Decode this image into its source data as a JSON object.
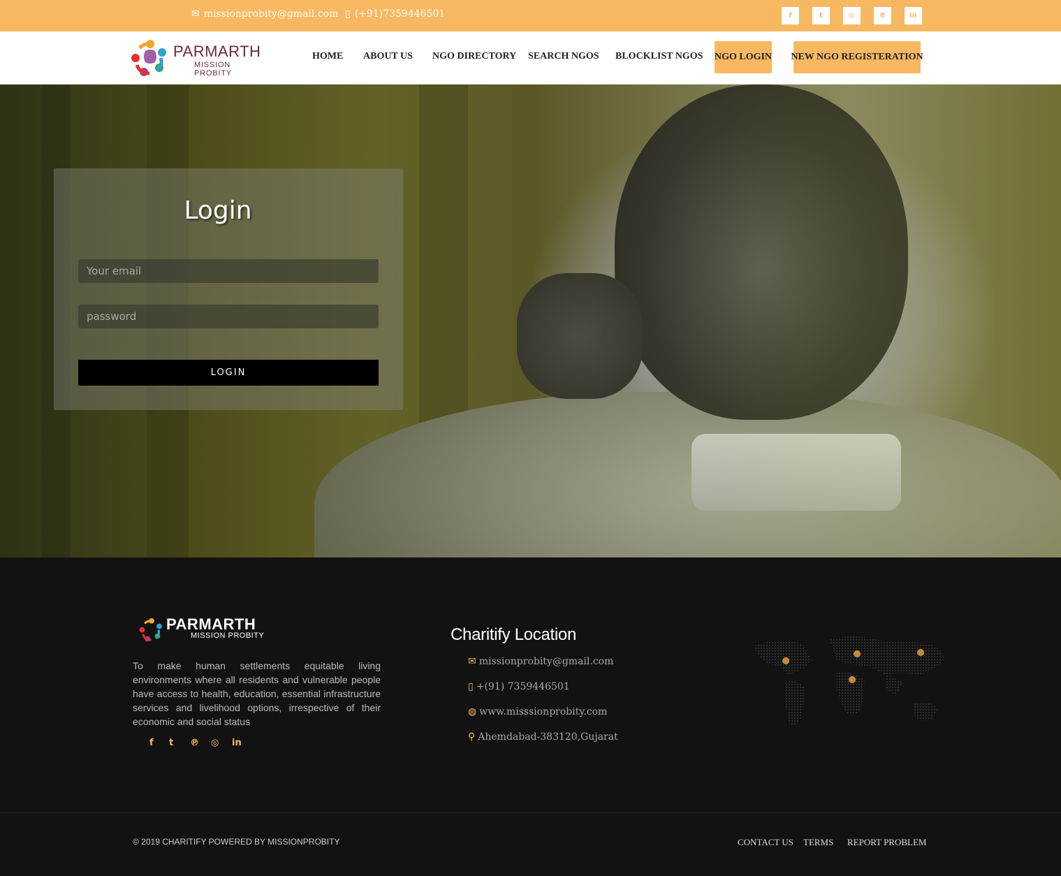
{
  "topbar": {
    "email": "missionprobity@gmail.com",
    "phone": "(+91)7359446501",
    "social": [
      "facebook-icon",
      "twitter-icon",
      "instagram-icon",
      "pinterest-icon",
      "linkedin-icon"
    ]
  },
  "brand": {
    "name": "PARMARTH",
    "tagline": "MISSION PROBITY"
  },
  "nav": {
    "home": "HOME",
    "about": "ABOUT US",
    "directory": "NGO DIRECTORY",
    "search": "SEARCH NGOS",
    "blocklist": "BLOCKLIST NGOS",
    "ngo_login": "NGO LOGIN",
    "register": "NEW NGO REGISTERATION"
  },
  "login": {
    "title": "Login",
    "email_placeholder": "Your email",
    "password_placeholder": "password",
    "button": "LOGIN"
  },
  "footer": {
    "description": "To make human settlements equitable living environments where all residents and vulnerable people have access to health, education, essential infrastructure services and livelihood options, irrespective of their economic and social status",
    "location_title": "Charitify Location",
    "email": "missionprobity@gmail.com",
    "phone": "+(91) 7359446501",
    "website": "www.misssionprobity.com",
    "address": "Ahemdabad-383120,Gujarat"
  },
  "bottom": {
    "copyright": "© 2019 CHARITIFY POWERED BY MISSIONPROBITY",
    "contact": "CONTACT US",
    "terms": "TERMS",
    "report": "REPORT PROBLEM"
  },
  "colors": {
    "accent": "#f7b861",
    "footer_bg": "#121212"
  }
}
